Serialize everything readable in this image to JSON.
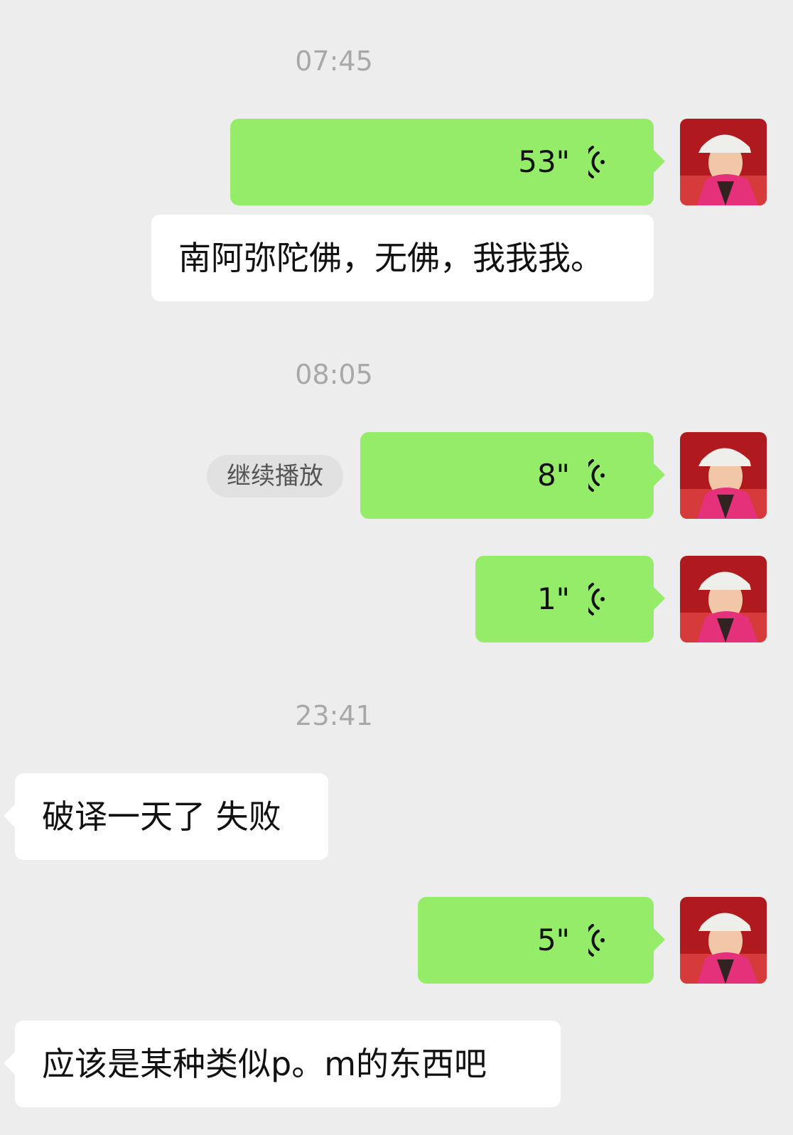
{
  "timestamps": [
    "07:45",
    "08:05",
    "23:41"
  ],
  "messages": {
    "m1": {
      "duration": "53\""
    },
    "m1_transcript": {
      "text": "南阿弥陀佛，无佛，我我我。"
    },
    "m2": {
      "duration": "8\""
    },
    "m2_continue": {
      "label": "继续播放"
    },
    "m3": {
      "duration": "1\""
    },
    "m4": {
      "text": "破译一天了 失败"
    },
    "m5": {
      "duration": "5\""
    },
    "m6": {
      "text": "应该是某种类似p。m的东西吧"
    }
  },
  "colors": {
    "background": "#ededed",
    "sent_bubble": "#95ec69",
    "received_bubble": "#ffffff",
    "timestamp": "#a8a8a8"
  },
  "icons": {
    "voice": "voice-wave-icon",
    "avatar": "user-avatar"
  }
}
